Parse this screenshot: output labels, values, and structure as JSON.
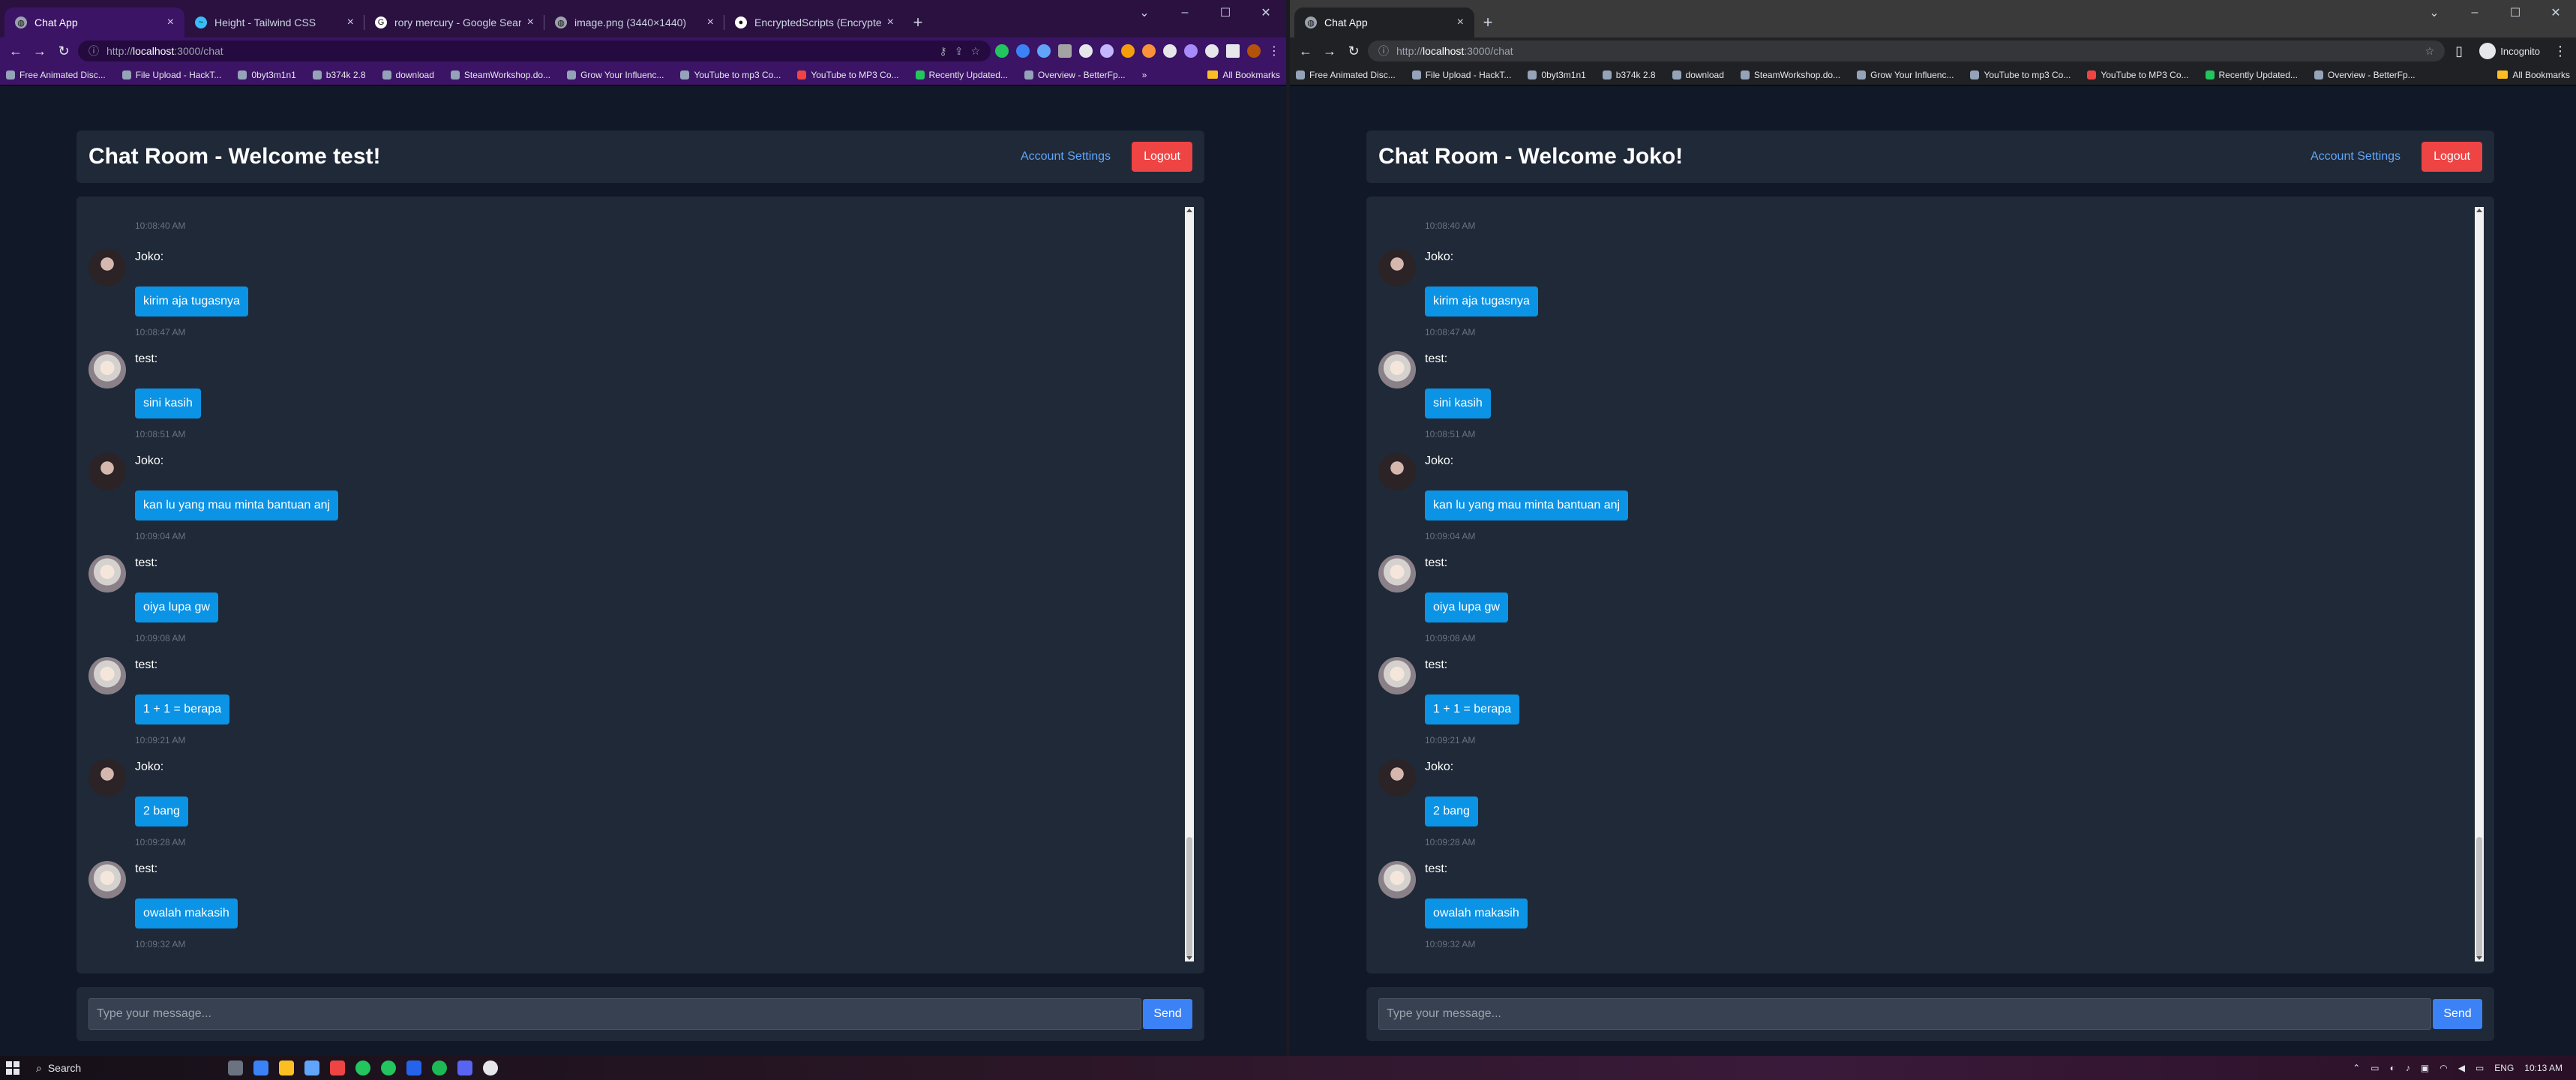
{
  "left": {
    "tabs": [
      {
        "title": "Chat App",
        "icon": "globe-icon",
        "active": true
      },
      {
        "title": "Height - Tailwind CSS",
        "icon": "tailwind-icon"
      },
      {
        "title": "rory mercury - Google Search",
        "icon": "google-icon"
      },
      {
        "title": "image.png (3440×1440)",
        "icon": "globe-icon"
      },
      {
        "title": "EncryptedScripts (Encrypted)",
        "icon": "github-icon"
      }
    ],
    "url_prefix": "http://",
    "url_host": "localhost",
    "url_rest": ":3000/chat",
    "welcome": "Chat Room - Welcome test!"
  },
  "right": {
    "tabs": [
      {
        "title": "Chat App",
        "icon": "globe-icon",
        "active": true
      }
    ],
    "url_prefix": "http://",
    "url_host": "localhost",
    "url_rest": ":3000/chat",
    "welcome": "Chat Room - Welcome Joko!",
    "incognito": "Incognito"
  },
  "bookmarks": [
    "Free Animated Disc...",
    "File Upload - HackT...",
    "0byt3m1n1",
    "b374k 2.8",
    "download",
    "SteamWorkshop.do...",
    "Grow Your Influenc...",
    "YouTube to mp3 Co...",
    "YouTube to MP3 Co...",
    "Recently Updated...",
    "Overview - BetterFp..."
  ],
  "bookmarks_more": "»",
  "all_bookmarks": "All Bookmarks",
  "header": {
    "account_settings": "Account Settings",
    "logout": "Logout"
  },
  "first_timestamp": "10:08:40 AM",
  "messages": [
    {
      "sender": "Joko:",
      "avatar": "joko",
      "text": "kirim aja tugasnya",
      "time": "10:08:47 AM"
    },
    {
      "sender": "test:",
      "avatar": "test",
      "text": "sini kasih",
      "time": "10:08:51 AM"
    },
    {
      "sender": "Joko:",
      "avatar": "joko",
      "text": "kan lu yang mau minta bantuan anj",
      "time": "10:09:04 AM"
    },
    {
      "sender": "test:",
      "avatar": "test",
      "text": "oiya lupa gw",
      "time": "10:09:08 AM"
    },
    {
      "sender": "test:",
      "avatar": "test",
      "text": "1 + 1 = berapa",
      "time": "10:09:21 AM"
    },
    {
      "sender": "Joko:",
      "avatar": "joko",
      "text": "2 bang",
      "time": "10:09:28 AM"
    },
    {
      "sender": "test:",
      "avatar": "test",
      "text": "owalah makasih",
      "time": "10:09:32 AM"
    }
  ],
  "input": {
    "placeholder": "Type your message...",
    "send": "Send"
  },
  "taskbar": {
    "search": "Search",
    "lang": "ENG",
    "time": "10:13 AM"
  }
}
